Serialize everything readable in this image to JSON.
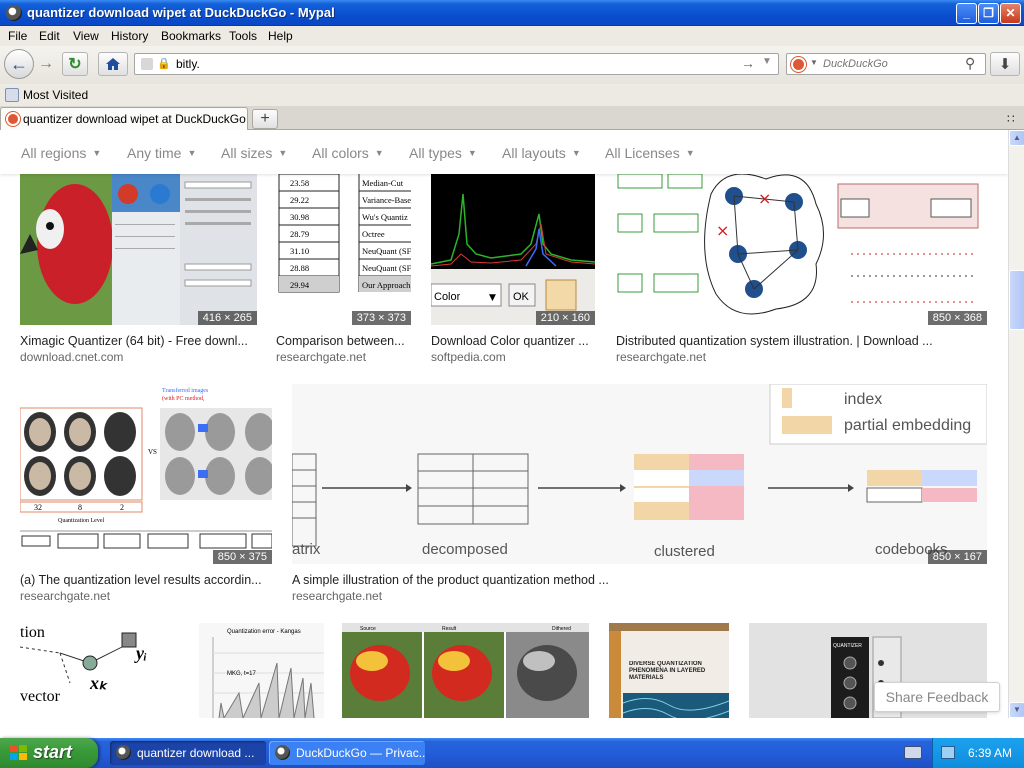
{
  "window": {
    "title": "quantizer download wipet at DuckDuckGo - Mypal",
    "min_glyph": "_",
    "max_glyph": "❐",
    "close_glyph": "✕"
  },
  "menu": {
    "file": "File",
    "edit": "Edit",
    "view": "View",
    "history": "History",
    "bookmarks": "Bookmarks",
    "tools": "Tools",
    "help": "Help"
  },
  "nav": {
    "url": "bitly.",
    "search_placeholder": "DuckDuckGo"
  },
  "bookmarks_bar": {
    "most_visited": "Most Visited"
  },
  "tabs": [
    {
      "label": "quantizer download wipet at DuckDuckGo"
    }
  ],
  "filters": [
    "All regions",
    "Any time",
    "All sizes",
    "All colors",
    "All types",
    "All layouts",
    "All Licenses"
  ],
  "results": [
    {
      "title": "Ximagic Quantizer (64 bit) - Free downl...",
      "source": "download.cnet.com",
      "dims": "416 × 265",
      "icon": "parrot-screenshot"
    },
    {
      "title": "Comparison between...",
      "source": "researchgate.net",
      "dims": "373 × 373",
      "icon": "comparison-table",
      "table_values": [
        "23.58",
        "29.22",
        "30.98",
        "28.79",
        "31.10",
        "28.88",
        "29.94"
      ],
      "table_labels": [
        "Median-Cut",
        "Variance-Base",
        "Wu's Quantiz",
        "Octree",
        "NeuQuant (SF",
        "NeuQuant (SF",
        "Our Approach"
      ]
    },
    {
      "title": "Download Color quantizer ...",
      "source": "softpedia.com",
      "dims": "210 × 160",
      "icon": "histogram-window",
      "dropdown_label": "Color",
      "ok_label": "OK"
    },
    {
      "title": "Distributed quantization system illustration. | Download ...",
      "source": "researchgate.net",
      "dims": "850 × 368",
      "icon": "network-diagram"
    },
    {
      "title": "(a) The quantization level results accordin...",
      "source": "researchgate.net",
      "dims": "850 × 375",
      "icon": "faces-figure",
      "levels": [
        "32",
        "8",
        "2"
      ],
      "level_label": "Quantization Level"
    },
    {
      "title": "A simple illustration of the product quantization method ...",
      "source": "researchgate.net",
      "dims": "850 × 167",
      "icon": "product-quantization",
      "legend_index": "index",
      "legend_partial": "partial embedding",
      "labels": [
        "atrix",
        "decomposed",
        "clustered",
        "codebooks"
      ]
    },
    {
      "icon": "vector-figure",
      "label_y": "yᵢ",
      "label_x": "xₖ",
      "label_top": "tion",
      "label_bottom": "vector"
    },
    {
      "icon": "error-chart",
      "chart_title": "Quantization error - Kangas",
      "chart_label": "MKG, t=17"
    },
    {
      "icon": "parrots-comparison",
      "captions": [
        "Source",
        "Result",
        "Dithered"
      ]
    },
    {
      "icon": "book-cover",
      "book_title": "DIVERSE QUANTIZATION PHENOMENA IN LAYERED MATERIALS"
    },
    {
      "icon": "quantizer-module",
      "module_label": "QUANTIZER"
    }
  ],
  "share_feedback": "Share Feedback",
  "taskbar": {
    "start": "start",
    "tasks": [
      "quantizer download ...",
      "DuckDuckGo — Privac..."
    ],
    "clock": "6:39 AM"
  },
  "colors": {
    "xp_blue": "#245edb",
    "start_green": "#3a9b3a",
    "duck_orange": "#de5833"
  }
}
